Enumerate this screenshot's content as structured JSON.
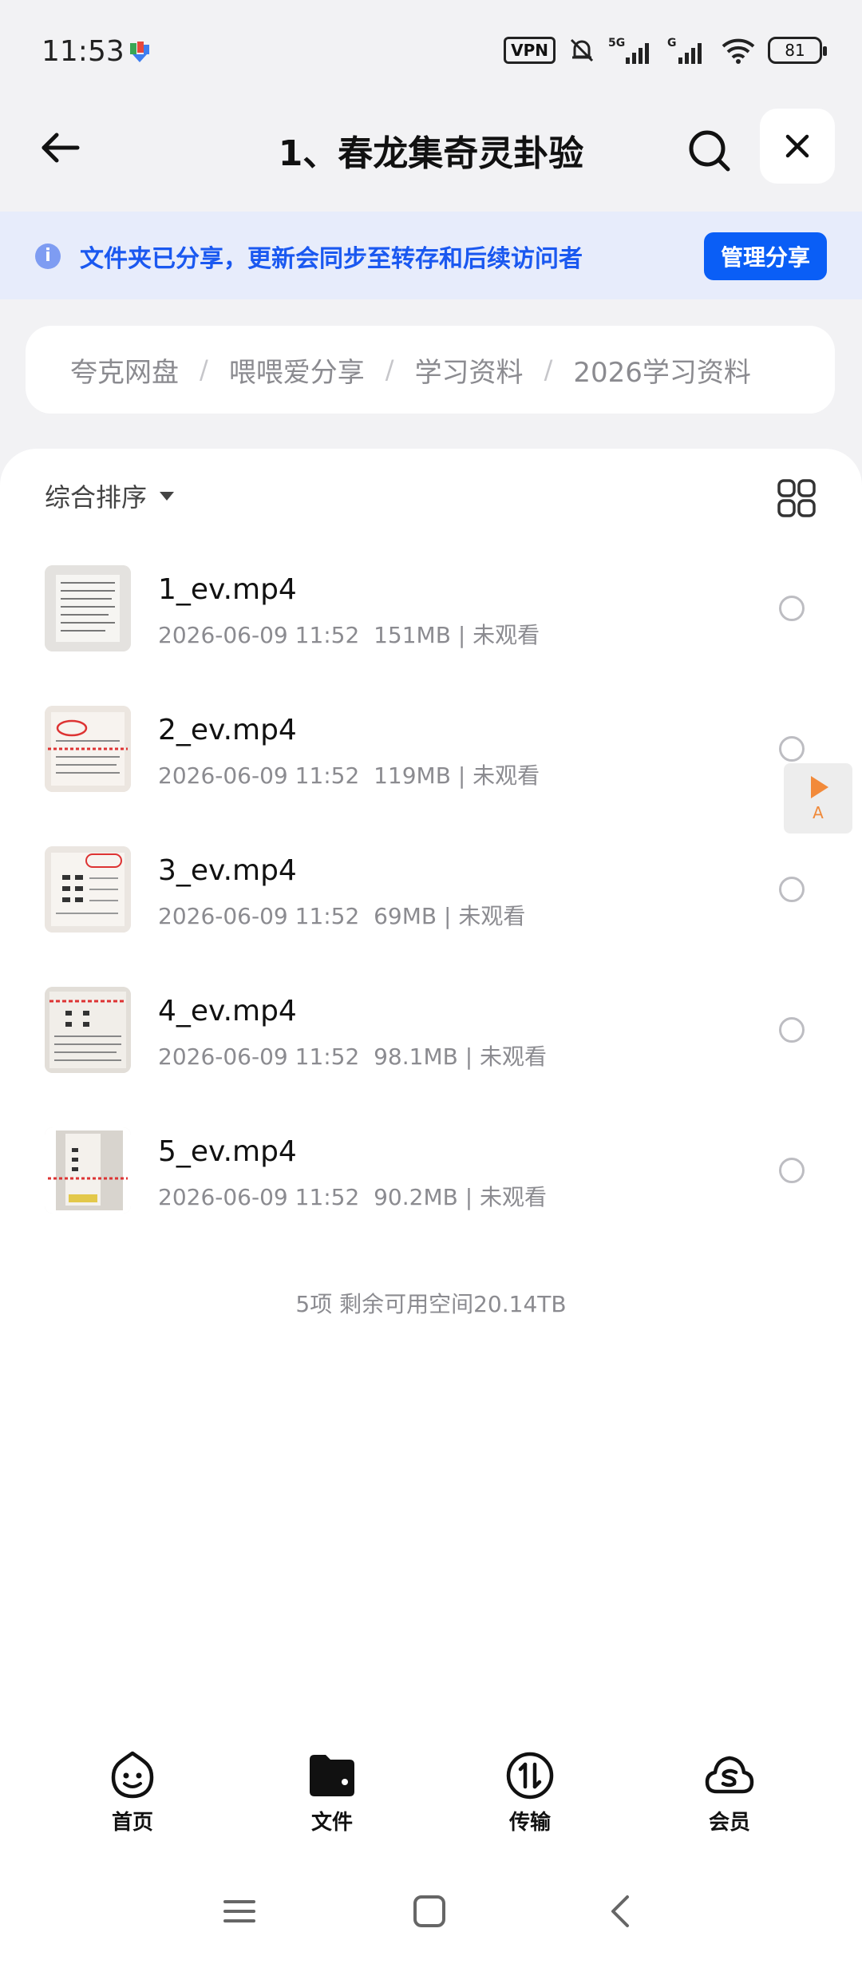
{
  "status_bar": {
    "time": "11:53",
    "vpn": "VPN",
    "network_5g": "5G",
    "network_g": "G",
    "battery": "81"
  },
  "header": {
    "title": "1、春龙集奇灵卦验"
  },
  "share_banner": {
    "text": "文件夹已分享，更新会同步至转存和后续访问者",
    "manage_label": "管理分享"
  },
  "breadcrumb": [
    "夸克网盘",
    "喂喂爱分享",
    "学习资料",
    "2026学习资料"
  ],
  "toolbar": {
    "sort_label": "综合排序"
  },
  "files": [
    {
      "name": "1_ev.mp4",
      "meta": "2026-06-09 11:52  151MB | 未观看"
    },
    {
      "name": "2_ev.mp4",
      "meta": "2026-06-09 11:52  119MB | 未观看"
    },
    {
      "name": "3_ev.mp4",
      "meta": "2026-06-09 11:52  69MB | 未观看"
    },
    {
      "name": "4_ev.mp4",
      "meta": "2026-06-09 11:52  98.1MB | 未观看"
    },
    {
      "name": "5_ev.mp4",
      "meta": "2026-06-09 11:52  90.2MB | 未观看"
    }
  ],
  "summary": "5项 剩余可用空间20.14TB",
  "float_player": {
    "label": "A"
  },
  "bottom_nav": [
    {
      "label": "首页",
      "icon": "smile-face-icon"
    },
    {
      "label": "文件",
      "icon": "folder-icon"
    },
    {
      "label": "传输",
      "icon": "transfer-icon"
    },
    {
      "label": "会员",
      "icon": "cloud-s-icon"
    }
  ],
  "colors": {
    "accent": "#0a5ef6",
    "banner_bg": "#e7ecfb",
    "banner_text": "#1a58f0",
    "page_bg": "#f2f2f4"
  }
}
